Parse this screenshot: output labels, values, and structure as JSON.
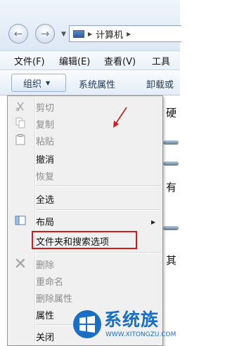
{
  "nav": {
    "address_path": "计算机",
    "back_glyph": "←",
    "forward_glyph": "→",
    "dropdown_glyph": "▼",
    "separator_glyph": "▶"
  },
  "menubar": {
    "items": [
      "文件(F)",
      "编辑(E)",
      "查看(V)",
      "工具"
    ]
  },
  "toolbar": {
    "organize_label": "组织",
    "organize_arrow": "▼",
    "buttons": [
      "系统属性",
      "卸载或"
    ]
  },
  "dropdown": {
    "items": [
      {
        "label": "剪切",
        "enabled": false,
        "icon": "scissors-icon"
      },
      {
        "label": "复制",
        "enabled": false,
        "icon": "copy-icon"
      },
      {
        "label": "粘贴",
        "enabled": false,
        "icon": "paste-icon"
      },
      {
        "label": "撤消",
        "enabled": true
      },
      {
        "label": "恢复",
        "enabled": false
      },
      {
        "label": "全选",
        "enabled": true
      },
      {
        "label": "布局",
        "enabled": true,
        "icon": "layout-icon",
        "submenu": true
      },
      {
        "label": "文件夹和搜索选项",
        "enabled": true,
        "highlighted": true
      },
      {
        "label": "删除",
        "enabled": false,
        "icon": "delete-x-icon"
      },
      {
        "label": "重命名",
        "enabled": false
      },
      {
        "label": "删除属性",
        "enabled": false
      },
      {
        "label": "属性",
        "enabled": true
      },
      {
        "label": "关闭",
        "enabled": true
      }
    ],
    "submenu_arrow": "▶"
  },
  "rightpane": {
    "chars": [
      "硬",
      "有",
      "其"
    ]
  },
  "watermark": {
    "text": "系统族",
    "url": "WWW.XITONGZU.COM"
  },
  "colors": {
    "highlight_border": "#d01c1c",
    "annotation_arrow": "#d01c1c",
    "watermark": "#1a6fc4"
  }
}
